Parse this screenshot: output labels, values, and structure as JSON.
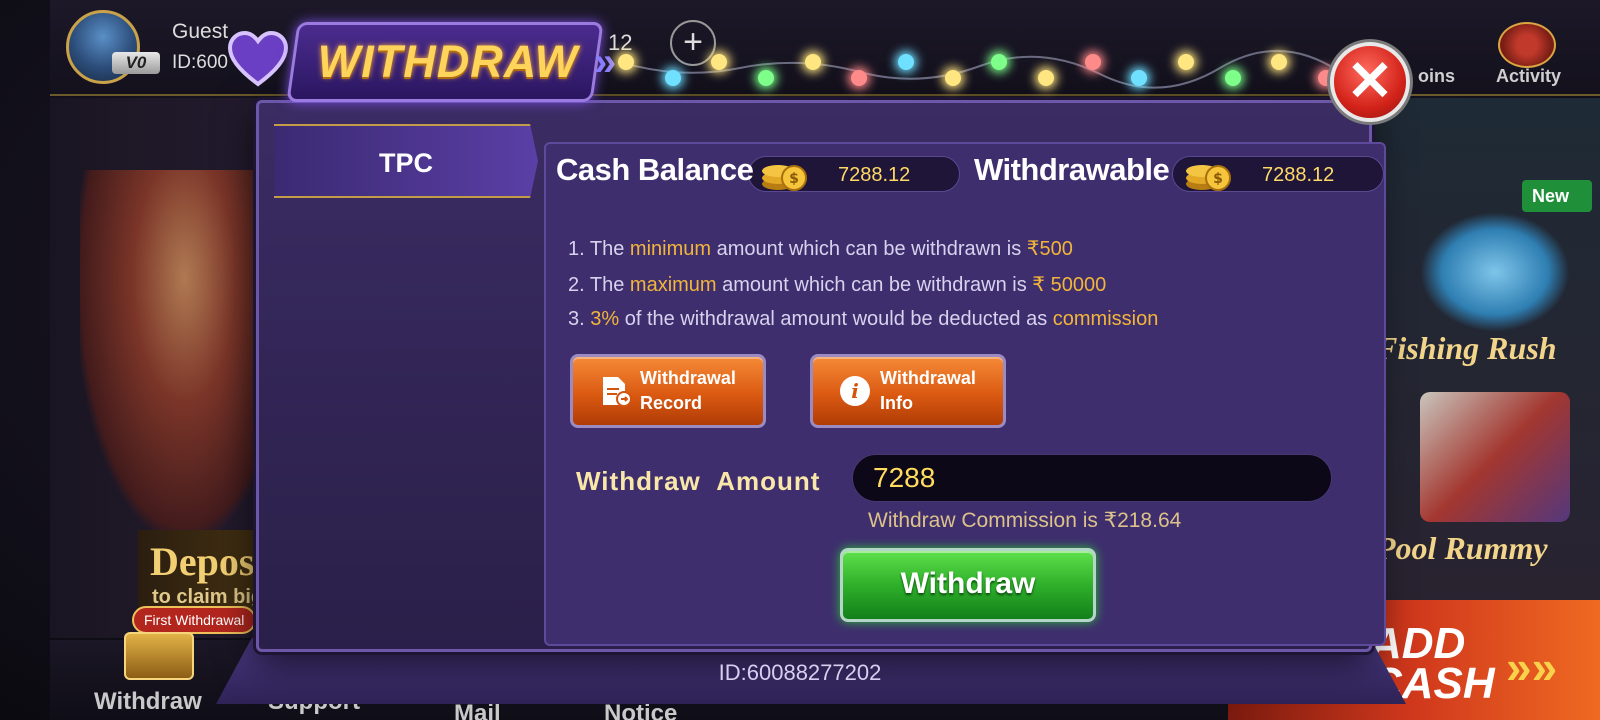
{
  "lobby": {
    "guest_name": "Guest",
    "guest_id": "ID:600",
    "vip_level": "V0",
    "balance_partial": "12",
    "add_symbol": "+",
    "coins_label": "oins",
    "activity_label": "Activity",
    "deposit_vip_title": "Deposit VIP",
    "deposit_vip_sub": "to claim big bonuses",
    "first_withdrawal_badge": "First Withdrawal",
    "nav": [
      "Withdraw",
      "Support",
      "Mail",
      "Notice"
    ],
    "new_badge": "New",
    "games": [
      "Fishing Rush",
      "Pool Rummy"
    ],
    "add_cash": "ADD\nCASH",
    "add_cash_arrows": "»»"
  },
  "modal": {
    "title": "WITHDRAW",
    "chevrons": "»",
    "close_symbol": "✕",
    "tab": "TPC",
    "cash_balance_label": "Cash Balance",
    "cash_balance_value": "7288.12",
    "withdrawable_label": "Withdrawable",
    "withdrawable_value": "7288.12",
    "rules": [
      {
        "pre": "1. The ",
        "hl": "minimum",
        "mid": " amount which can be withdrawn is ",
        "hl2": "₹500",
        "post": ""
      },
      {
        "pre": "2. The ",
        "hl": "maximum",
        "mid": " amount which can be withdrawn is ",
        "hl2": "₹ 50000",
        "post": ""
      },
      {
        "pre": "3. ",
        "hl": "3%",
        "mid": " of the withdrawal amount would be deducted as ",
        "hl2": "commission",
        "post": ""
      }
    ],
    "record_button": "Withdrawal\nRecord",
    "info_button": "Withdrawal\nInfo",
    "amount_label": "Withdraw  Amount",
    "amount_value": "7288",
    "commission_text": "Withdraw Commission is ₹218.64",
    "withdraw_button": "Withdraw",
    "footer_id": "ID:60088277202"
  },
  "colors": {
    "accent_gold": "#f2b53a",
    "withdraw_green": "#2fb02a",
    "panel_purple": "#3e2e6e",
    "close_red": "#d3231a"
  },
  "lights": [
    "#ffe680",
    "#6fe0ff",
    "#ffe680",
    "#7dff8a",
    "#ffe680",
    "#ff8a8a",
    "#6fe0ff",
    "#ffe680",
    "#7dff8a",
    "#ffe680",
    "#ff8a8a",
    "#6fe0ff",
    "#ffe680",
    "#7dff8a",
    "#ffe680",
    "#ff8a8a"
  ]
}
